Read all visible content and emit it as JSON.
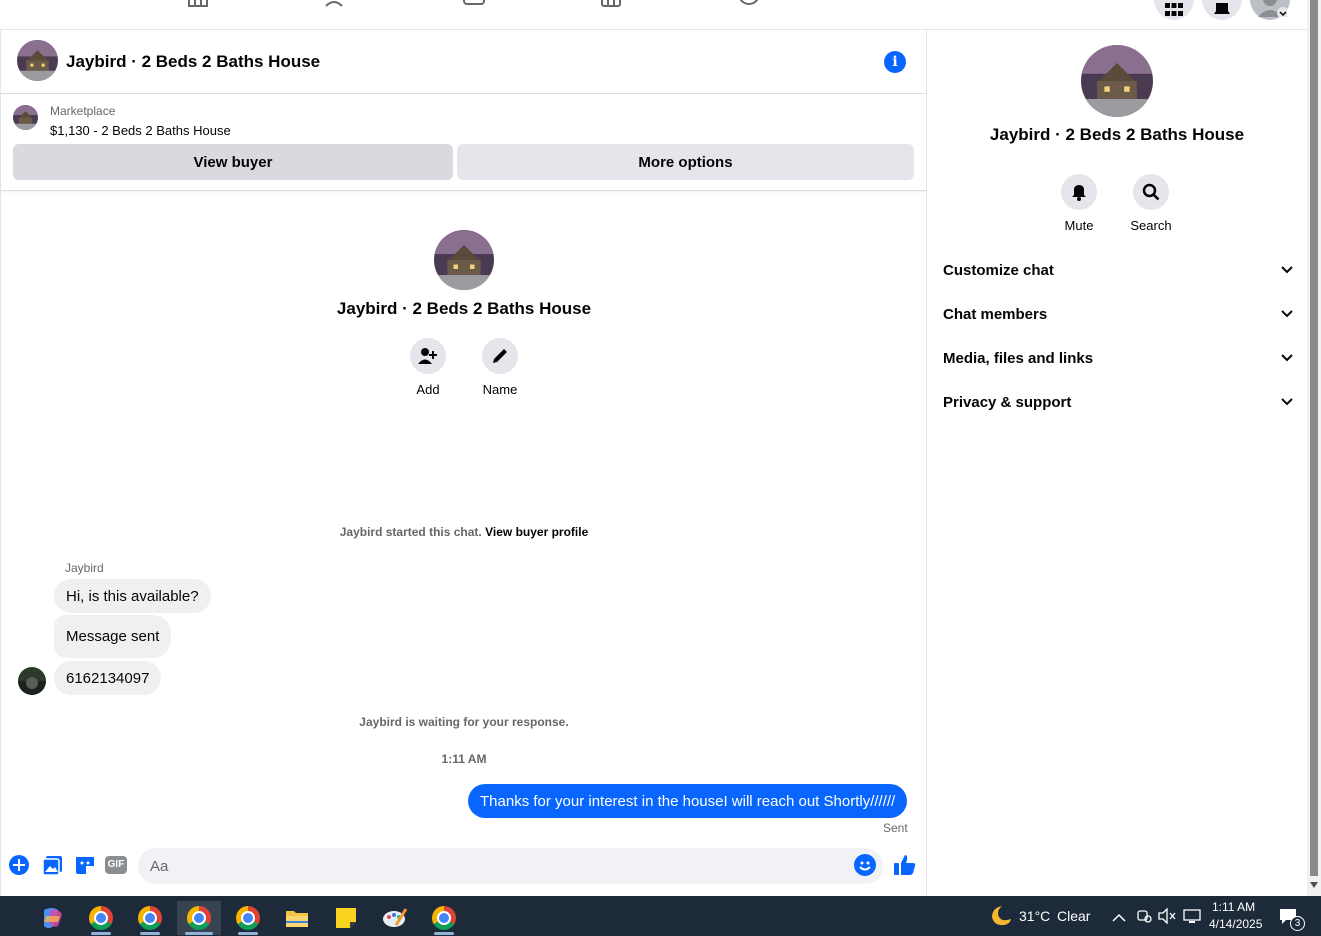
{
  "colors": {
    "accent": "#0866ff",
    "bubble_in": "#f0f0f0",
    "button_bg": "#e4e6eb",
    "muted_text": "#65676b",
    "taskbar_bg": "#1c2a3a"
  },
  "topnav": {
    "icons": [
      "home-icon",
      "friends-icon",
      "video-icon",
      "marketplace-icon",
      "groups-icon",
      "menu-grid-icon",
      "notifications-icon",
      "account-icon"
    ]
  },
  "chat_header": {
    "title": "Jaybird · 2 Beds 2 Baths House",
    "info_icon": "info-icon"
  },
  "listing": {
    "label": "Marketplace",
    "price_title": "$1,130 - 2 Beds 2 Baths House",
    "view_buyer": "View buyer",
    "more_options": "More options"
  },
  "intro": {
    "title": "Jaybird · 2 Beds 2 Baths House",
    "actions": [
      {
        "label": "Add",
        "icon": "add-person-icon"
      },
      {
        "label": "Name",
        "icon": "pencil-icon"
      }
    ]
  },
  "conversation": {
    "started_text": "Jaybird started this chat.",
    "started_link": "View buyer profile",
    "sender_name": "Jaybird",
    "incoming": [
      "Hi, is this available?",
      "Message sent",
      "6162134097"
    ],
    "waiting_text": "Jaybird is waiting for your response.",
    "timestamp": "1:11 AM",
    "outgoing": "Thanks for your interest in the houseI will reach out Shortly//////",
    "sent_status": "Sent"
  },
  "composer": {
    "placeholder": "Aa",
    "icons": [
      "plus-icon",
      "photo-icon",
      "sticker-icon",
      "gif-icon",
      "emoji-icon",
      "thumbs-up-icon"
    ],
    "gif_label": "GIF"
  },
  "details": {
    "title": "Jaybird · 2 Beds 2 Baths House",
    "actions": [
      {
        "label": "Mute",
        "icon": "bell-icon"
      },
      {
        "label": "Search",
        "icon": "search-icon"
      }
    ],
    "sections": [
      "Customize chat",
      "Chat members",
      "Media, files and links",
      "Privacy & support"
    ]
  },
  "taskbar": {
    "weather_temp": "31°C",
    "weather_desc": "Clear",
    "time": "1:11 AM",
    "date": "4/14/2025",
    "notification_count": "3"
  }
}
